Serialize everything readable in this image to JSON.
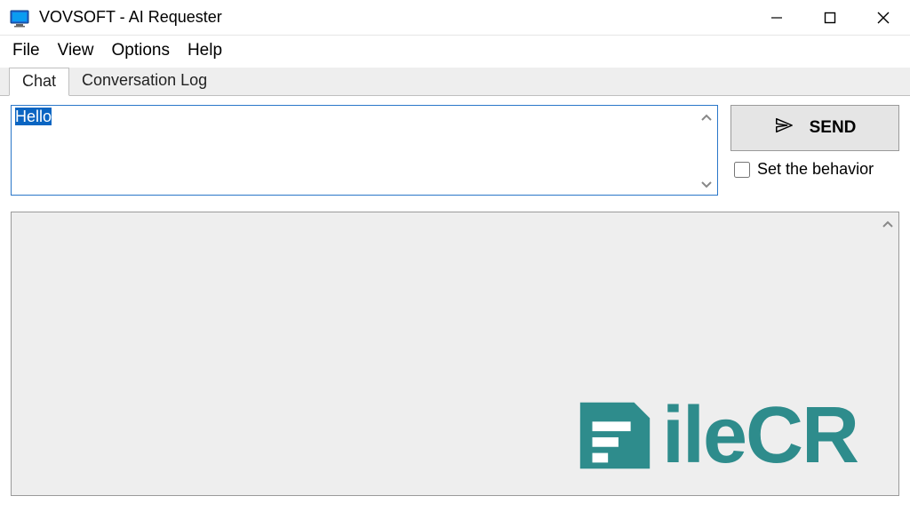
{
  "window": {
    "title": "VOVSOFT - AI Requester"
  },
  "menu": {
    "file": "File",
    "view": "View",
    "options": "Options",
    "help": "Help"
  },
  "tabs": {
    "chat": "Chat",
    "log": "Conversation Log"
  },
  "input": {
    "value": "Hello"
  },
  "actions": {
    "send": "SEND",
    "behavior": "Set the behavior"
  },
  "watermark": {
    "text": "ileCR"
  }
}
